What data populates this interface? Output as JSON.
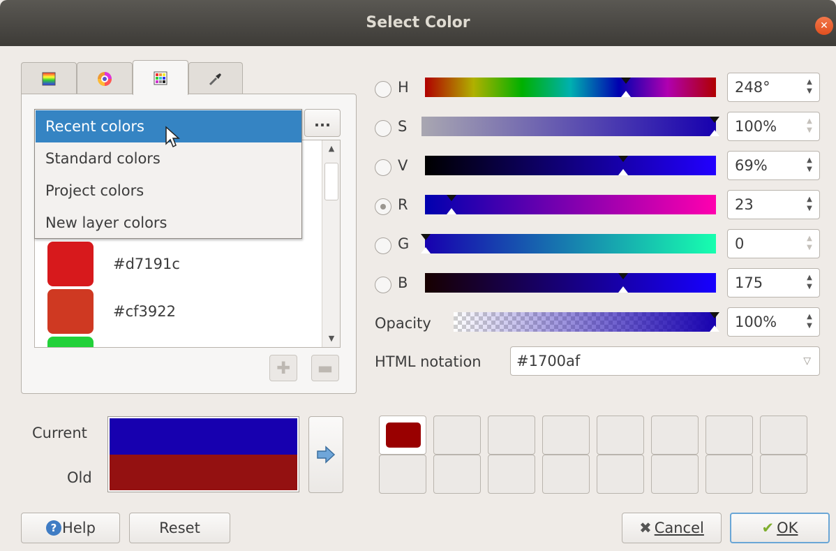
{
  "window": {
    "title": "Select Color"
  },
  "tabs": [
    {
      "name": "color-ramp",
      "icon": "color-ramp-icon"
    },
    {
      "name": "color-wheel",
      "icon": "color-wheel-icon"
    },
    {
      "name": "color-swatches",
      "icon": "swatch-grid-icon",
      "active": true
    },
    {
      "name": "color-picker",
      "icon": "eyedropper-icon"
    }
  ],
  "scheme_dropdown": {
    "options": [
      "Recent colors",
      "Standard colors",
      "Project colors",
      "New layer colors"
    ],
    "selected": "Recent colors",
    "more_label": "..."
  },
  "swatch_list": [
    {
      "hex": "#d7191c",
      "color": "#d7191c"
    },
    {
      "hex": "#cf3922",
      "color": "#cf3922"
    },
    {
      "hex": "",
      "color": "#22d13a"
    }
  ],
  "channels": {
    "h": {
      "label": "H",
      "value": "248°",
      "level": 0.69
    },
    "s": {
      "label": "S",
      "value": "100%",
      "level": 1.0
    },
    "v": {
      "label": "V",
      "value": "69%",
      "level": 0.69
    },
    "r": {
      "label": "R",
      "value": "23",
      "level": 0.09,
      "selected": true
    },
    "g": {
      "label": "G",
      "value": "0",
      "level": 0.0
    },
    "b": {
      "label": "B",
      "value": "175",
      "level": 0.69
    },
    "opacity": {
      "label": "Opacity",
      "value": "100%",
      "level": 1.0
    }
  },
  "html_notation": {
    "label": "HTML notation",
    "value": "#1700af"
  },
  "preview": {
    "current_label": "Current",
    "old_label": "Old",
    "current_color": "#1700af",
    "old_color": "#941111"
  },
  "custom_swatches": [
    "#990000",
    "",
    "",
    "",
    "",
    "",
    "",
    "",
    "",
    "",
    "",
    "",
    "",
    "",
    "",
    ""
  ],
  "buttons": {
    "help": "Help",
    "reset": "Reset",
    "cancel": "Cancel",
    "ok": "OK"
  }
}
